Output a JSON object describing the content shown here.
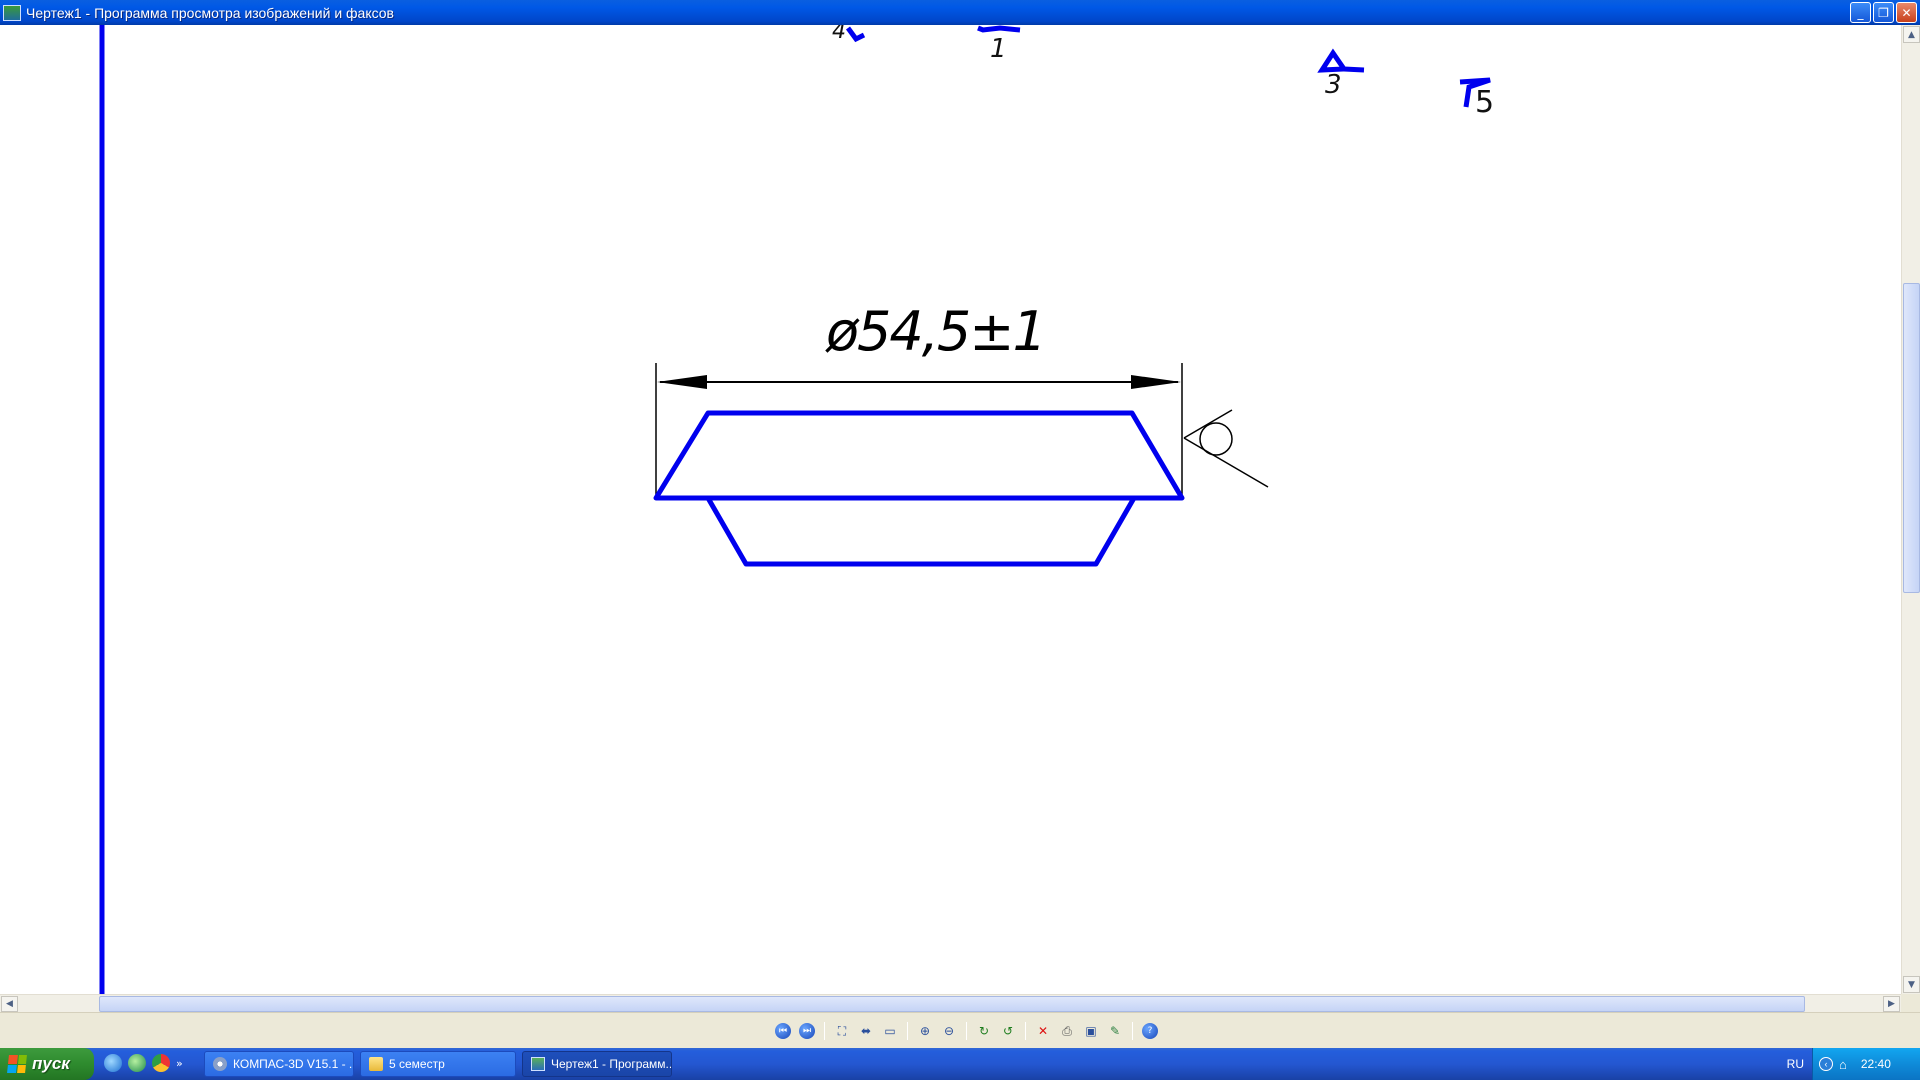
{
  "window": {
    "title": "Чертеж1 - Программа просмотра изображений и факсов",
    "buttons": [
      "_",
      "❐",
      "✕"
    ]
  },
  "drawing": {
    "dimension_text": "ø54,5±1",
    "markers": [
      "4",
      "1",
      "3",
      "5"
    ],
    "line_color": "#0000ee"
  },
  "toolbar": {
    "groups": [
      [
        "previous-image-icon",
        "next-image-icon"
      ],
      [
        "best-fit-icon",
        "actual-size-icon",
        "slideshow-icon"
      ],
      [
        "zoom-in-icon",
        "zoom-out-icon"
      ],
      [
        "rotate-clockwise-icon",
        "rotate-counterclockwise-icon"
      ],
      [
        "delete-icon",
        "print-icon",
        "save-icon",
        "open-in-editor-icon"
      ],
      [
        "help-icon"
      ]
    ]
  },
  "taskbar": {
    "start_label": "пуск",
    "tasks": [
      {
        "label": "КОМПАС-3D V15.1 - ...",
        "icon": "kompas-icon",
        "active": false
      },
      {
        "label": "5 семестр",
        "icon": "folder-icon",
        "active": false
      },
      {
        "label": "Чертеж1 - Программ...",
        "icon": "image-viewer-icon",
        "active": true
      }
    ],
    "language": "RU",
    "clock": "22:40"
  }
}
